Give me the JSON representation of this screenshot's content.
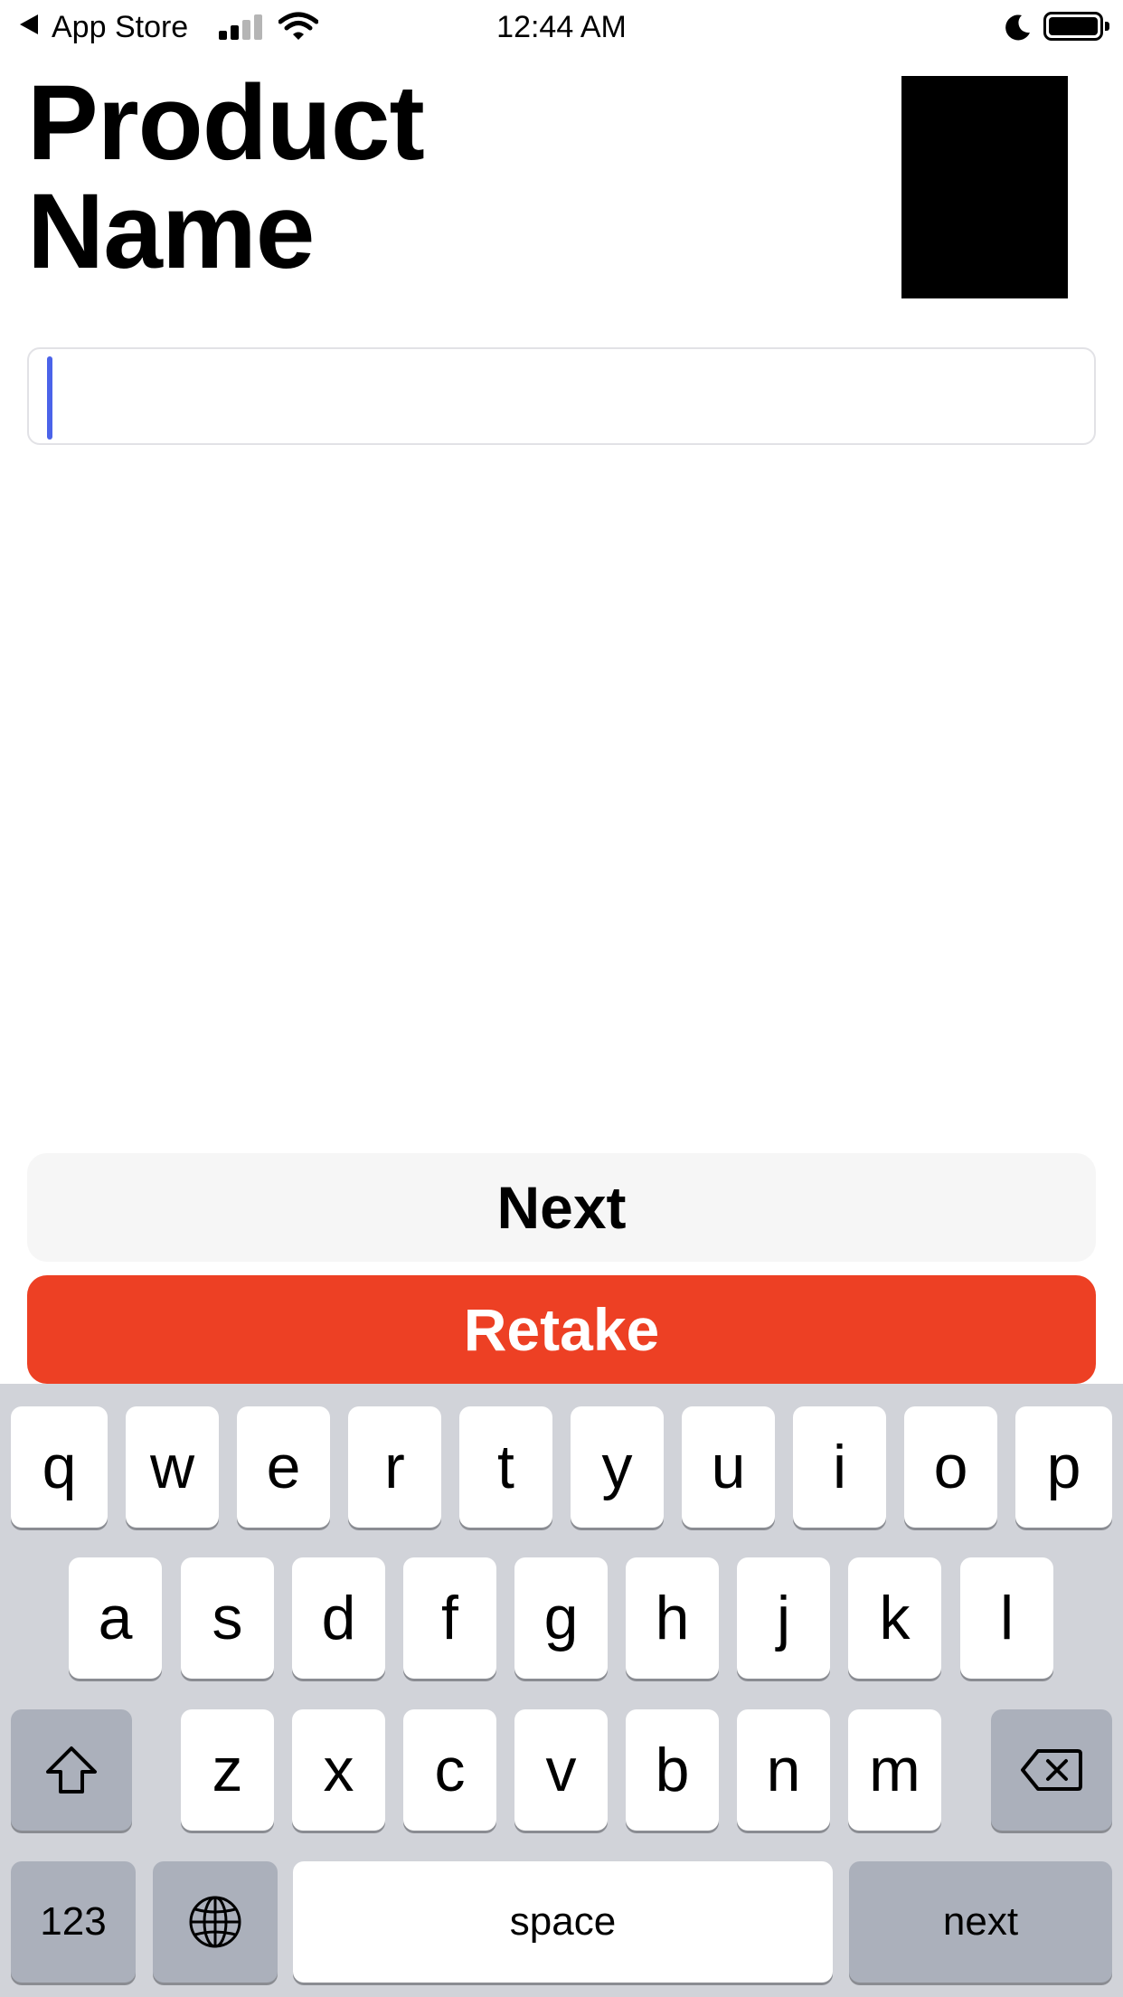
{
  "status_bar": {
    "back_app": "App Store",
    "time": "12:44 AM",
    "icons": [
      "back-arrow-icon",
      "cellular-signal-icon",
      "wifi-icon",
      "do-not-disturb-moon-icon",
      "battery-icon"
    ]
  },
  "page": {
    "title": "Product Name",
    "product_image": "product-photo-thumbnail"
  },
  "input": {
    "value": "",
    "placeholder": ""
  },
  "buttons": {
    "next_label": "Next",
    "retake_label": "Retake"
  },
  "colors": {
    "accent_retake": "#ED4024",
    "caret": "#4B63E9",
    "keyboard_bg": "#D1D3D9"
  },
  "keyboard": {
    "row1": [
      "q",
      "w",
      "e",
      "r",
      "t",
      "y",
      "u",
      "i",
      "o",
      "p"
    ],
    "row2": [
      "a",
      "s",
      "d",
      "f",
      "g",
      "h",
      "j",
      "k",
      "l"
    ],
    "row3": [
      "z",
      "x",
      "c",
      "v",
      "b",
      "n",
      "m"
    ],
    "numbers_label": "123",
    "space_label": "space",
    "return_label": "next",
    "icons": [
      "shift-icon",
      "delete-icon",
      "globe-icon"
    ]
  }
}
